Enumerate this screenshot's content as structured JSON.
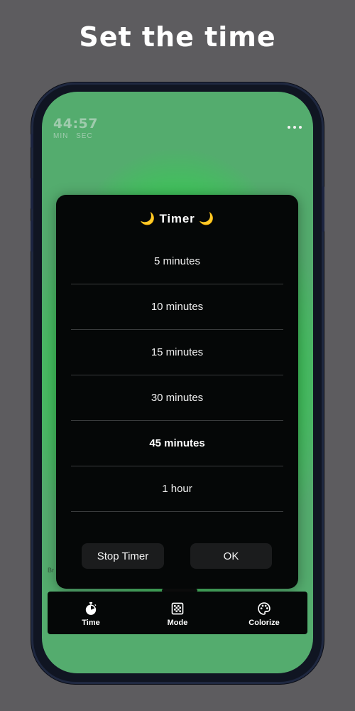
{
  "headline": "Set the time",
  "clock": {
    "value": "44:57",
    "units": [
      "MIN",
      "SEC"
    ]
  },
  "side_label": "Br",
  "dialog": {
    "title": "🌙 Timer 🌙",
    "options": [
      "5 minutes",
      "10 minutes",
      "15 minutes",
      "30 minutes",
      "45 minutes",
      "1 hour"
    ],
    "selected": "45 minutes",
    "stop_label": "Stop Timer",
    "ok_label": "OK"
  },
  "tabbar": {
    "items": [
      {
        "label": "Time",
        "icon": "stopwatch-icon"
      },
      {
        "label": "Mode",
        "icon": "grid-icon"
      },
      {
        "label": "Colorize",
        "icon": "palette-icon"
      }
    ]
  },
  "colors": {
    "background": "#5d5c5f",
    "screen_glow": "#15f520",
    "dialog": "#050707",
    "button": "#1b1c1d"
  }
}
